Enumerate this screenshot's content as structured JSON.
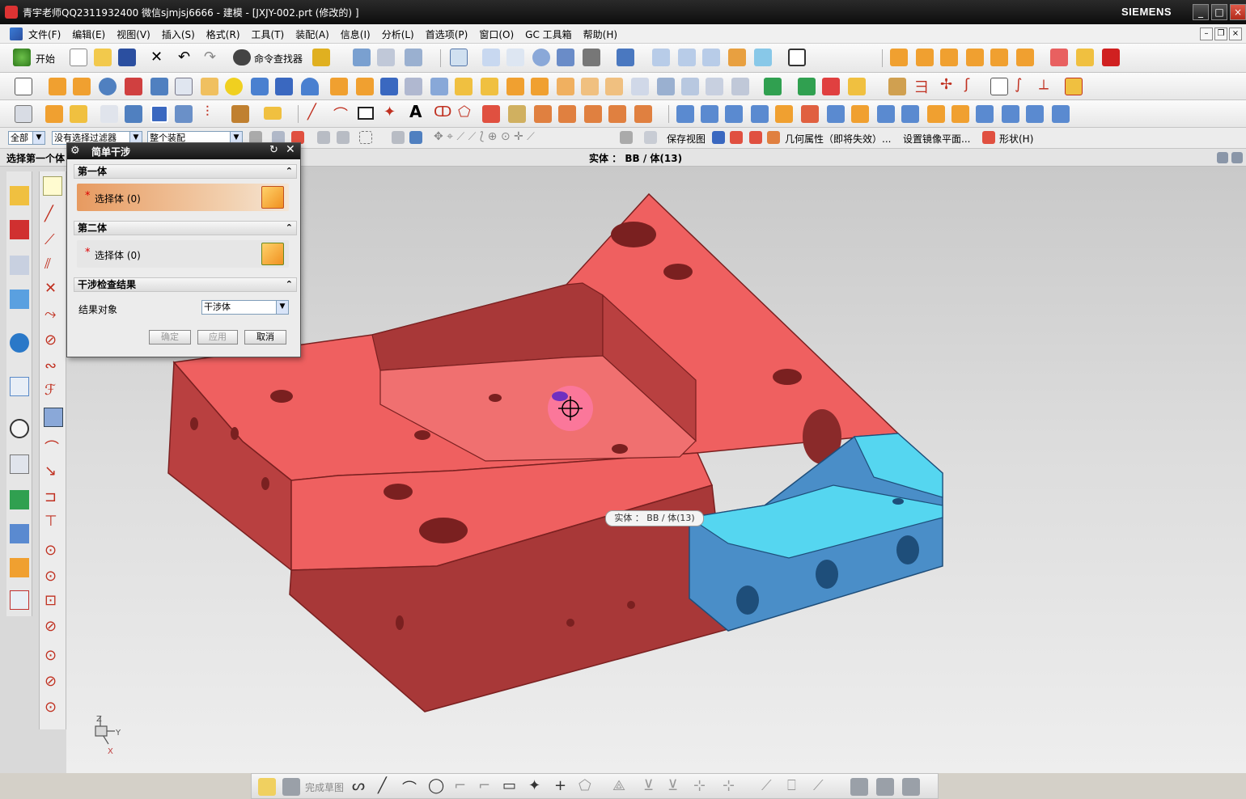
{
  "window": {
    "title": "青宇老师QQ2311932400 微信sjmjsj6666 - 建模 - [JXJY-002.prt  (修改的) ]",
    "brand": "SIEMENS",
    "controls": [
      "_",
      "□",
      "×"
    ]
  },
  "menu": {
    "items": [
      "文件(F)",
      "编辑(E)",
      "视图(V)",
      "插入(S)",
      "格式(R)",
      "工具(T)",
      "装配(A)",
      "信息(I)",
      "分析(L)",
      "首选项(P)",
      "窗口(O)",
      "GC 工具箱",
      "帮助(H)"
    ]
  },
  "toolbar1": {
    "start_label": "开始",
    "command_finder_label": "命令查找器"
  },
  "selection_bar": {
    "filter_all": "全部",
    "filter_none": "没有选择过滤器",
    "scope": "整个装配",
    "save_view": "保存视图",
    "geom_props": "几何属性（即将失效）...",
    "mirror_plane": "设置镜像平面...",
    "shape": "形状(H)"
  },
  "status": {
    "prompt": "选择第一个体",
    "selection_info": "实体 ： BB / 体(13)"
  },
  "dialog": {
    "title": "简单干涉",
    "group1": {
      "title": "第一体",
      "select_label": "选择体 (0)"
    },
    "group2": {
      "title": "第二体",
      "select_label": "选择体 (0)"
    },
    "group3": {
      "title": "干涉检查结果",
      "field_label": "结果对象",
      "field_value": "干涉体"
    },
    "buttons": {
      "ok": "确定",
      "apply": "应用",
      "cancel": "取消"
    }
  },
  "tooltip": {
    "text": "实体 ： BB / 体(13)"
  },
  "bottom_toolbar": {
    "finish_sketch": "完成草图"
  },
  "axis_labels": {
    "z": "Z",
    "y": "Y",
    "x": "X"
  },
  "colors": {
    "part_red": "#ef6060",
    "part_red_dark": "#a83838",
    "insert_blue": "#4a8ec8",
    "insert_cyan": "#55d6f0",
    "titlebar": "#111111"
  }
}
